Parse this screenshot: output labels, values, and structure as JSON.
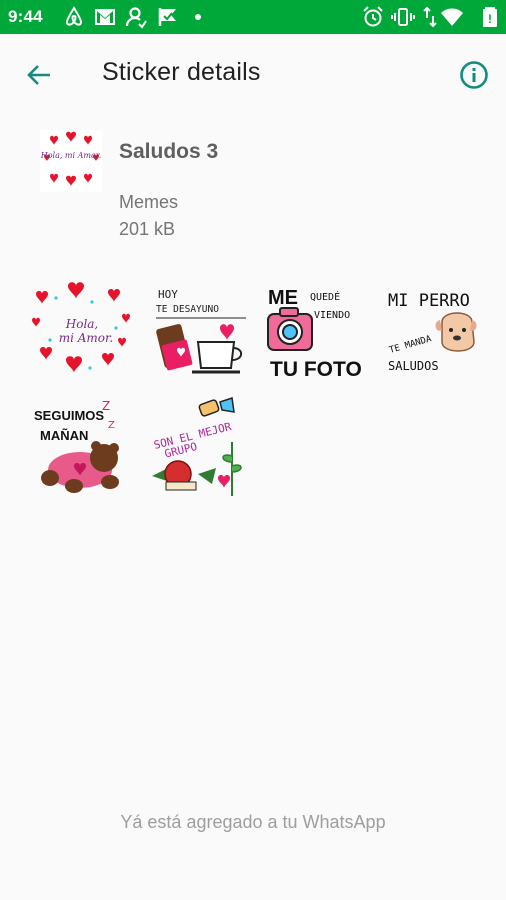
{
  "status_bar": {
    "time": "9:44",
    "background": "#00a83a",
    "left_icons": [
      "airbnb-icon",
      "gmail-icon",
      "person-icon",
      "flag-icon",
      "dot-icon"
    ],
    "right_icons": [
      "alarm-icon",
      "vibrate-icon",
      "data-arrows-icon",
      "wifi-icon",
      "battery-icon"
    ]
  },
  "app_bar": {
    "title": "Sticker details",
    "back_icon": "arrow-back-icon",
    "info_icon": "info-icon",
    "accent": "#128c7e"
  },
  "pack": {
    "name": "Saludos 3",
    "publisher": "Memes",
    "size": "201 kB",
    "tray_text": "Hola, mi Amor."
  },
  "stickers": [
    {
      "id": "hola-amor",
      "lines": [
        "Hola,",
        "mi Amor."
      ]
    },
    {
      "id": "desayuno",
      "lines": [
        "HOY",
        "TE DESAYUNO"
      ]
    },
    {
      "id": "foto",
      "lines": [
        "ME",
        "QUEDÉ",
        "VIENDO",
        "TU FOTO"
      ]
    },
    {
      "id": "perro",
      "lines": [
        "MI PERRO",
        "TE MANDA",
        "SALUDOS"
      ]
    },
    {
      "id": "seguimos",
      "lines": [
        "SEGUIMOS",
        "MAÑAN",
        "Z",
        "Z"
      ]
    },
    {
      "id": "mejor-grupo",
      "lines": [
        "SON EL MEJOR",
        "GRUPO"
      ]
    }
  ],
  "footer": {
    "text": "Yá está agregado a tu WhatsApp"
  }
}
